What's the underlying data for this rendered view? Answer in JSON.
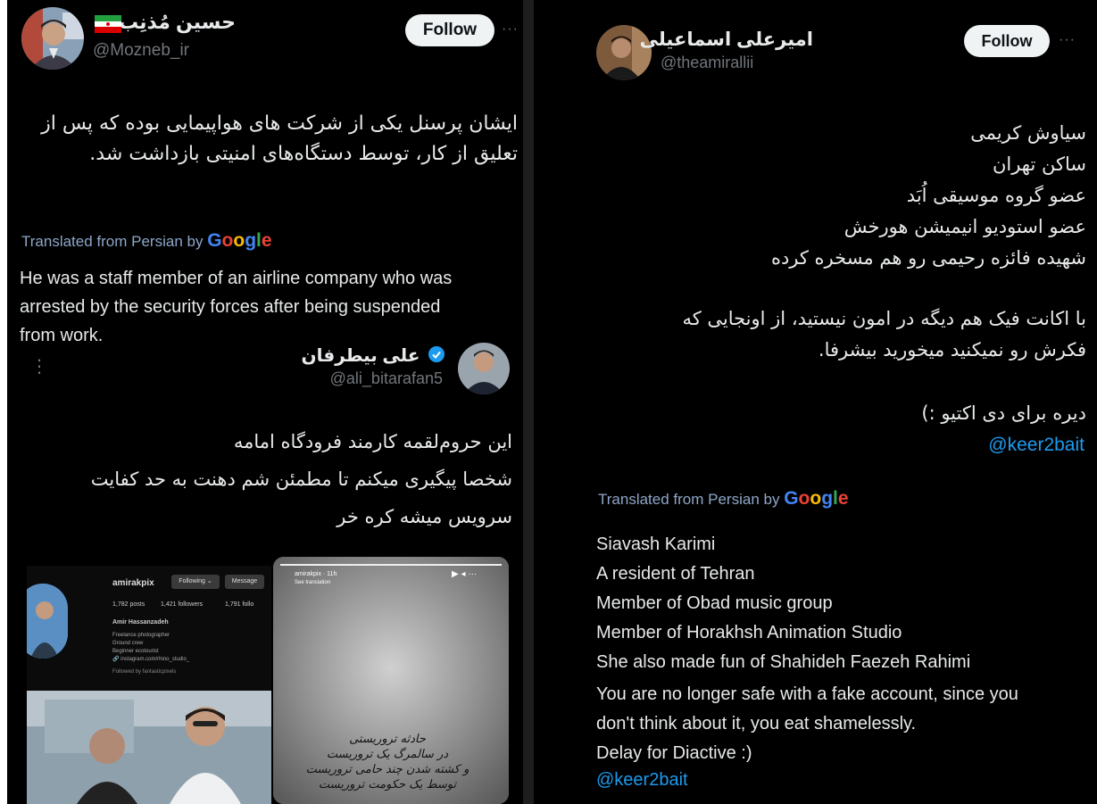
{
  "left_tweet": {
    "author_name": "حسین مُذنِب",
    "flag": "🇮🇷",
    "handle": "@Mozneb_ir",
    "follow_label": "Follow",
    "more": "···",
    "text_lines": [
      "ایشان پرسنل یکی از شرکت های هواپیمایی بوده که پس از",
      "تعلیق از کار، توسط دستگاه‌های امنیتی بازداشت شد."
    ],
    "translated_prefix": "Translated from Persian by",
    "google_letters": [
      "G",
      "o",
      "o",
      "g",
      "l",
      "e"
    ],
    "translation_lines": [
      "He was a staff member of an airline company who was",
      "arrested by the security forces after being suspended",
      "from work."
    ],
    "quoted": {
      "author_name": "علی بیطرفان",
      "handle": "@ali_bitarafan5",
      "menu_icon": "⋮",
      "text_lines": [
        "این حروم‌لقمه کارمند فرودگاه امامه",
        "شخصا پیگیری میکنم تا مطمئن شم دهنت به حد کفایت",
        "سرویس میشه کره خر"
      ],
      "profile": {
        "username": "amirakpix",
        "following_label": "Following ⌄",
        "message_label": "Message",
        "posts": "1,782 posts",
        "followers": "1,421 followers",
        "following": "1,791 follo",
        "full_name": "Amir Hassanzadeh",
        "bio_lines": [
          "Freelance photographer",
          "Ground crew",
          "Beginner ecotourist",
          "🔗 instagram.com/rhino_studio_"
        ],
        "followed_by": "Followed by fantasticpixels"
      },
      "story": {
        "user": "amirakpix · 11h",
        "see_translation": "See translation",
        "caption_lines": [
          "حادثه تروریستی",
          "در سالمرگ یک تروریست",
          "و کشته شدن چند حامی تروریست",
          "توسط یک حکومت تروریست"
        ]
      }
    }
  },
  "right_tweet": {
    "author_name": "امیرعلی اسماعیلی",
    "handle": "@theamirallii",
    "follow_label": "Follow",
    "more": "···",
    "text_lines_block1": [
      "سیاوش کریمی",
      "ساکن تهران",
      "عضو گروه موسیقی اُبَد",
      "عضو استودیو انیمیشن هورخش",
      "شهیده فائزه رحیمی رو هم مسخره کرده"
    ],
    "text_lines_block2": [
      "با اکانت فیک هم دیگه در امون نیستید، از اونجایی که",
      "فکرش رو نمیکنید میخورید بیشرفا."
    ],
    "text_line_block3": "دیره برای دی اکتیو :)",
    "mention": "@keer2bait",
    "translated_prefix": "Translated from Persian by",
    "google_letters": [
      "G",
      "o",
      "o",
      "g",
      "l",
      "e"
    ],
    "translation_lines_block1": [
      "Siavash Karimi",
      "A resident of Tehran",
      "Member of Obad music group",
      "Member of Horakhsh Animation Studio",
      "She also made fun of Shahideh Faezeh Rahimi"
    ],
    "translation_lines_block2": [
      "You are no longer safe with a fake account, since you",
      "don't think about it, you eat shamelessly."
    ],
    "translation_line_block3": "Delay for Diactive :)",
    "translation_mention": "@keer2bait"
  },
  "colors": {
    "background": "#000000",
    "text": "#e7e9ea",
    "muted": "#71767b",
    "link": "#1d9bf0",
    "translated": "#8ea6c8",
    "verified": "#1d9bf0"
  }
}
